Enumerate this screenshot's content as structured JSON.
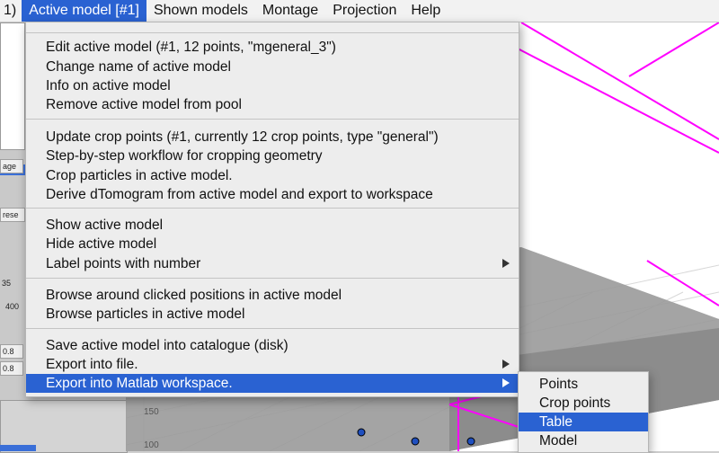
{
  "menubar": {
    "items": [
      {
        "label": "1)"
      },
      {
        "label": "Active model [#1]"
      },
      {
        "label": "Shown models"
      },
      {
        "label": "Montage"
      },
      {
        "label": "Projection"
      },
      {
        "label": "Help"
      }
    ]
  },
  "background": {
    "cell_labels": [
      "age",
      "rese",
      "35",
      "400",
      "0.8",
      "0.8"
    ],
    "plot_ticks": [
      "150",
      "100"
    ]
  },
  "menu": {
    "items": [
      "Edit active model (#1, 12 points, \"mgeneral_3\")",
      "Change name of active model",
      "Info on active model",
      "Remove active model from pool",
      "Update crop points (#1, currently 12 crop points, type \"general\")",
      "Step-by-step workflow for cropping geometry",
      "Crop particles in active model.",
      "Derive dTomogram from active model and export to workspace",
      "Show active model",
      "Hide active model",
      "Label points with number",
      "Browse around clicked positions in active model",
      "Browse particles in active model",
      "Save active model into catalogue (disk)",
      "Export into file.",
      "Export into Matlab workspace."
    ]
  },
  "submenu": {
    "items": [
      "Points",
      "Crop points",
      "Table",
      "Model"
    ]
  },
  "colors": {
    "accent": "#2a62d2",
    "box_edges": "#ff00ff",
    "surface": "#9a9a9a",
    "points": "#1f4fbf"
  }
}
